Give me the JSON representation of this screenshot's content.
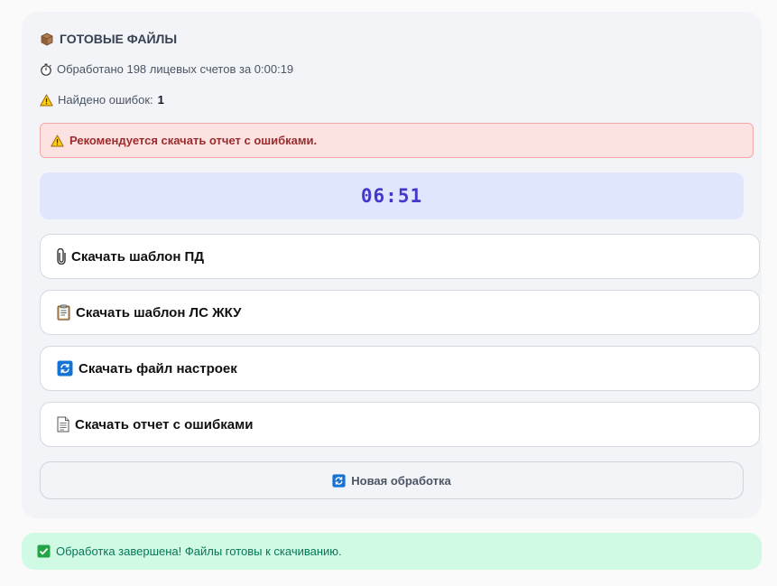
{
  "card": {
    "title": "ГОТОВЫЕ ФАЙЛЫ",
    "processed_text": "Обработано 198 лицевых счетов за 0:00:19",
    "errors_label": "Найдено ошибок: ",
    "errors_count": "1"
  },
  "alert": {
    "text": "Рекомендуется скачать отчет с ошибками."
  },
  "timer": {
    "value": "06:51"
  },
  "buttons": [
    {
      "label": "Скачать шаблон ПД",
      "icon": "paperclip-icon"
    },
    {
      "label": "Скачать шаблон ЛС ЖКУ",
      "icon": "clipboard-icon"
    },
    {
      "label": "Скачать файл настроек",
      "icon": "refresh-icon"
    },
    {
      "label": "Скачать отчет с ошибками",
      "icon": "document-icon"
    }
  ],
  "new_button": {
    "label": "Новая обработка",
    "icon": "refresh-icon"
  },
  "success": {
    "text": "Обработка завершена! Файлы готовы к скачиванию.",
    "icon": "check-icon"
  },
  "colors": {
    "alert_bg": "#fde2e2",
    "alert_text": "#9b2c2c",
    "timer_bg": "#e0e6fe",
    "timer_text": "#4338ca",
    "success_bg": "#d1fae5",
    "success_text": "#047857"
  }
}
